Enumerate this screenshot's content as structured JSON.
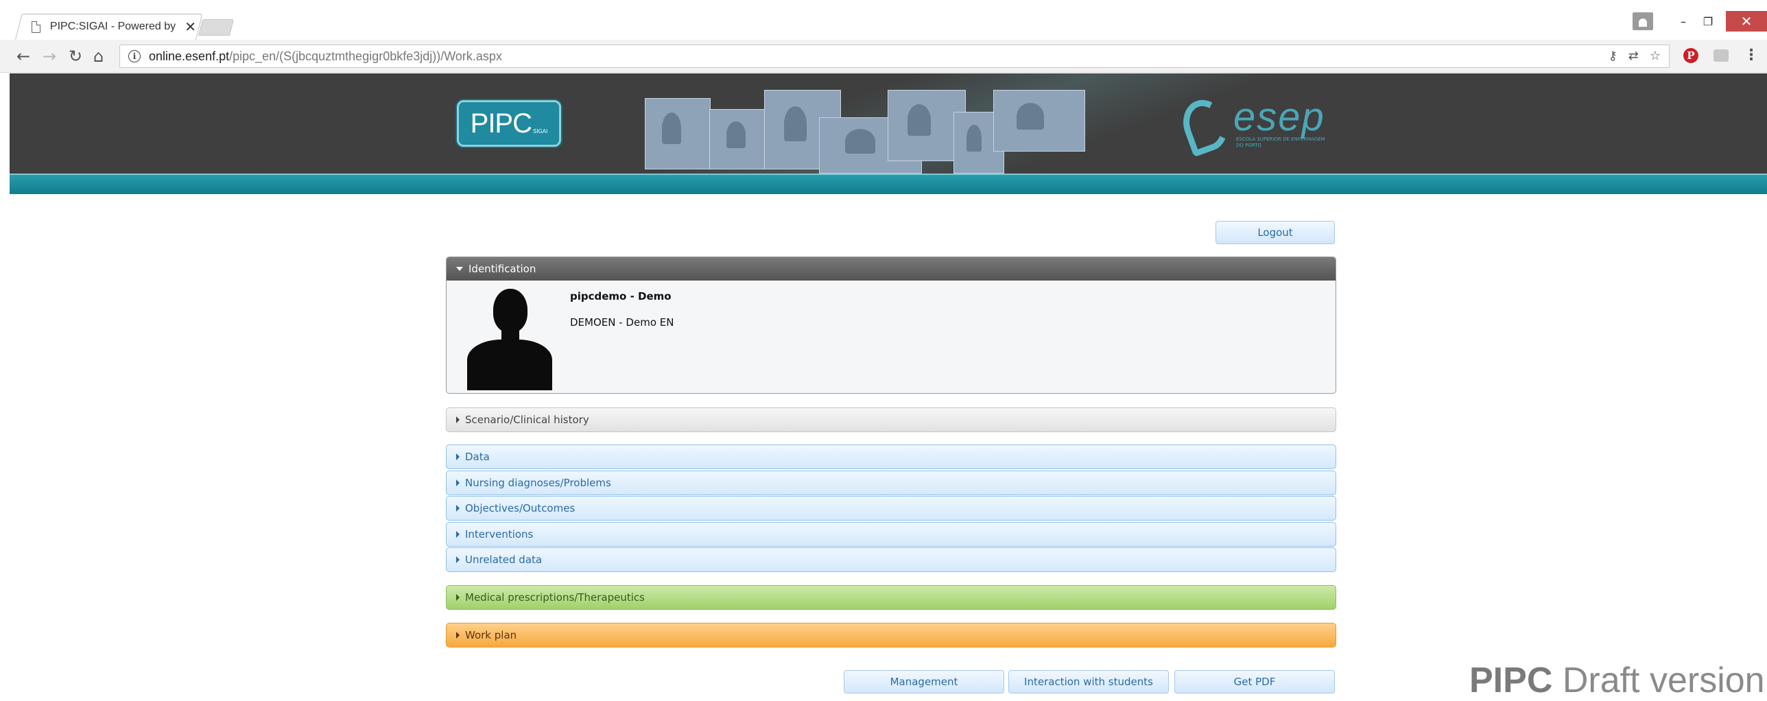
{
  "browser": {
    "tab_title": "PIPC:SIGAI - Powered by",
    "tab_close": "✕",
    "url_host": "online.esenf.pt",
    "url_path": "/pipc_en/(S(jbcquztmthegigr0bkfe3jdj))/Work.aspx",
    "window_controls": {
      "minimize": "–",
      "restore": "❐",
      "close": "✕"
    }
  },
  "header": {
    "logo_text": "PIPC",
    "logo_sub": "SIGAI",
    "partner_logo": "esep",
    "partner_sub": "ESCOLA SUPERIOR DE ENFERMAGEM DO PORTO",
    "brand_color": "#1f8aa0"
  },
  "actions": {
    "logout": "Logout"
  },
  "identification": {
    "title": "Identification",
    "name": "pipcdemo - Demo",
    "organization": "DEMOEN - Demo EN"
  },
  "sections": {
    "scenario": "Scenario/Clinical history",
    "data": "Data",
    "diagnoses": "Nursing diagnoses/Problems",
    "objectives": "Objectives/Outcomes",
    "interventions": "Interventions",
    "unrelated": "Unrelated data",
    "medical": "Medical prescriptions/Therapeutics",
    "workplan": "Work plan"
  },
  "footer_buttons": {
    "management": "Management",
    "interaction": "Interaction with students",
    "pdf": "Get PDF"
  },
  "watermark": {
    "bold": "PIPC",
    "rest": " Draft version"
  }
}
